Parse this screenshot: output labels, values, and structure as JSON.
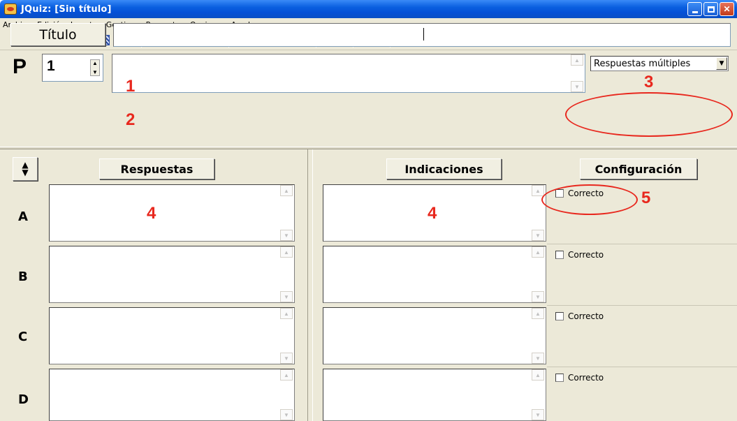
{
  "window": {
    "title": "JQuiz: [Sin título]"
  },
  "menu": [
    "Archivo",
    "Edición",
    "Insertar",
    "Gestionar Preguntas",
    "Opciones",
    "Ayuda"
  ],
  "header": {
    "titulo_label": "Título",
    "titulo_value": "",
    "question_prefix": "P",
    "question_number": "1",
    "question_text": "",
    "question_type": "Respuestas múltiples"
  },
  "columns": {
    "responses": "Respuestas",
    "indications": "Indicaciones",
    "configuration": "Configuración"
  },
  "rows": [
    {
      "letter": "A",
      "correct_label": "Correcto"
    },
    {
      "letter": "B",
      "correct_label": "Correcto"
    },
    {
      "letter": "C",
      "correct_label": "Correcto"
    },
    {
      "letter": "D",
      "correct_label": "Correcto"
    }
  ],
  "annotations": [
    "1",
    "2",
    "3",
    "4",
    "4",
    "5"
  ],
  "colors": {
    "annotation": "#e8281e",
    "titlebar": "#0a5fe0",
    "face": "#ece9d8"
  }
}
